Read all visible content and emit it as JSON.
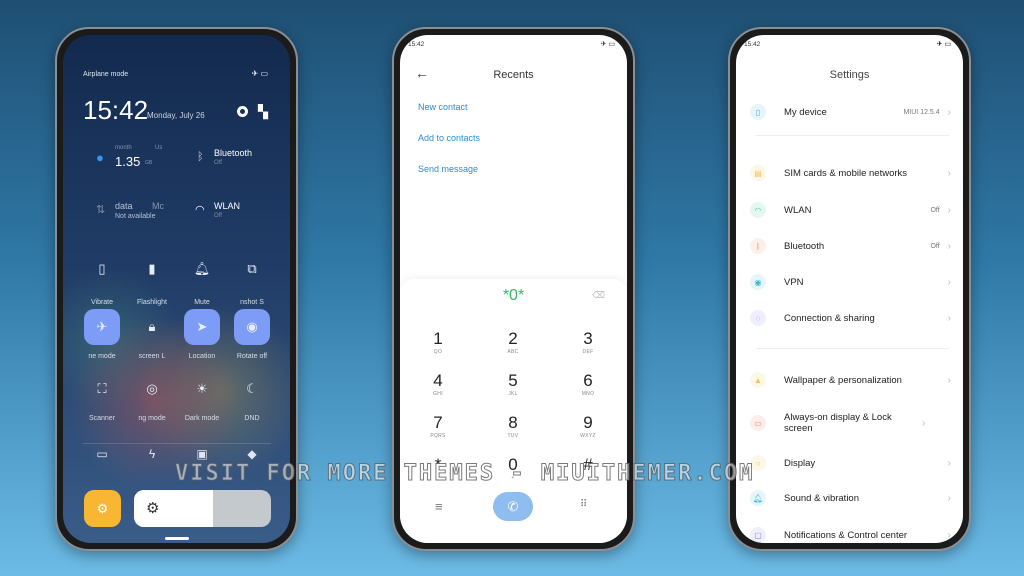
{
  "control_center": {
    "status": "Airplane mode",
    "time": "15:42",
    "date": "Monday, July 26",
    "data_usage": {
      "label_a": "month",
      "label_b": "Us",
      "value": "1.35",
      "unit": "GB"
    },
    "bluetooth": {
      "label": "Bluetooth",
      "state": "Off"
    },
    "mobile_data": {
      "label_a": "data",
      "label_b": "Mc",
      "state": "Not available"
    },
    "wlan": {
      "label": "WLAN",
      "state": "Off"
    },
    "tiles": [
      {
        "label": "Vibrate",
        "icon": "vibrate-icon",
        "on": false
      },
      {
        "label": "Flashlight",
        "icon": "flashlight-icon",
        "on": false
      },
      {
        "label": "Mute",
        "icon": "bell-icon",
        "on": false
      },
      {
        "label": "nshot  S",
        "icon": "screenshot-icon",
        "on": false
      },
      {
        "label": "ne mode",
        "icon": "airplane-icon",
        "on": true
      },
      {
        "label": "screen   L",
        "icon": "lock-icon",
        "on": false
      },
      {
        "label": "Location",
        "icon": "location-icon",
        "on": true
      },
      {
        "label": "Rotate off",
        "icon": "rotate-lock-icon",
        "on": true
      },
      {
        "label": "Scanner",
        "icon": "scanner-icon",
        "on": false
      },
      {
        "label": "ng mode",
        "icon": "eye-icon",
        "on": false
      },
      {
        "label": "Dark mode",
        "icon": "sun-icon",
        "on": false
      },
      {
        "label": "DND",
        "icon": "moon-icon",
        "on": false
      }
    ],
    "bottom_icons": [
      "battery-saver-icon",
      "bolt-icon",
      "cast-icon",
      "code-icon"
    ],
    "accent": "#7d9cf5",
    "auto_brightness_color": "#f7b733",
    "brightness": 0.58
  },
  "dialer": {
    "time": "15:42",
    "title": "Recents",
    "actions": [
      "New contact",
      "Add to contacts",
      "Send message"
    ],
    "input": "*0*",
    "keys": [
      [
        "1",
        "QO"
      ],
      [
        "2",
        "ABC"
      ],
      [
        "3",
        "DEF"
      ],
      [
        "4",
        "GHI"
      ],
      [
        "5",
        "JKL"
      ],
      [
        "6",
        "MNO"
      ],
      [
        "7",
        "PQRS"
      ],
      [
        "8",
        "TUV"
      ],
      [
        "9",
        "WXYZ"
      ],
      [
        "*",
        ","
      ],
      [
        "0",
        "+"
      ],
      [
        "#",
        ""
      ]
    ]
  },
  "settings": {
    "time": "15:42",
    "title": "Settings",
    "items": [
      {
        "label": "My device",
        "value": "MIUI 12.5.4",
        "icon": "phone-icon",
        "color": "#3bb3d6"
      },
      {
        "label": "SIM cards & mobile networks",
        "value": "",
        "icon": "sim-icon",
        "color": "#f2c14e"
      },
      {
        "label": "WLAN",
        "value": "Off",
        "icon": "wifi-icon",
        "color": "#38c79a"
      },
      {
        "label": "Bluetooth",
        "value": "Off",
        "icon": "bluetooth-icon",
        "color": "#ee8a5f"
      },
      {
        "label": "VPN",
        "value": "",
        "icon": "vpn-icon",
        "color": "#3bb3d6"
      },
      {
        "label": "Connection & sharing",
        "value": "",
        "icon": "connection-icon",
        "color": "#7d7cf0"
      },
      {
        "label": "Wallpaper & personalization",
        "value": "",
        "icon": "wallpaper-icon",
        "color": "#f2c14e"
      },
      {
        "label": "Always-on display & Lock screen",
        "value": "",
        "icon": "lock-screen-icon",
        "color": "#ee7a6a"
      },
      {
        "label": "Display",
        "value": "",
        "icon": "display-icon",
        "color": "#f2c14e"
      },
      {
        "label": "Sound & vibration",
        "value": "",
        "icon": "bell-icon",
        "color": "#3bb3d6"
      },
      {
        "label": "Notifications & Control center",
        "value": "",
        "icon": "notifications-icon",
        "color": "#7d7cf0"
      }
    ]
  },
  "watermark": "VISIT FOR MORE THEMES - MIUITHEMER.COM"
}
